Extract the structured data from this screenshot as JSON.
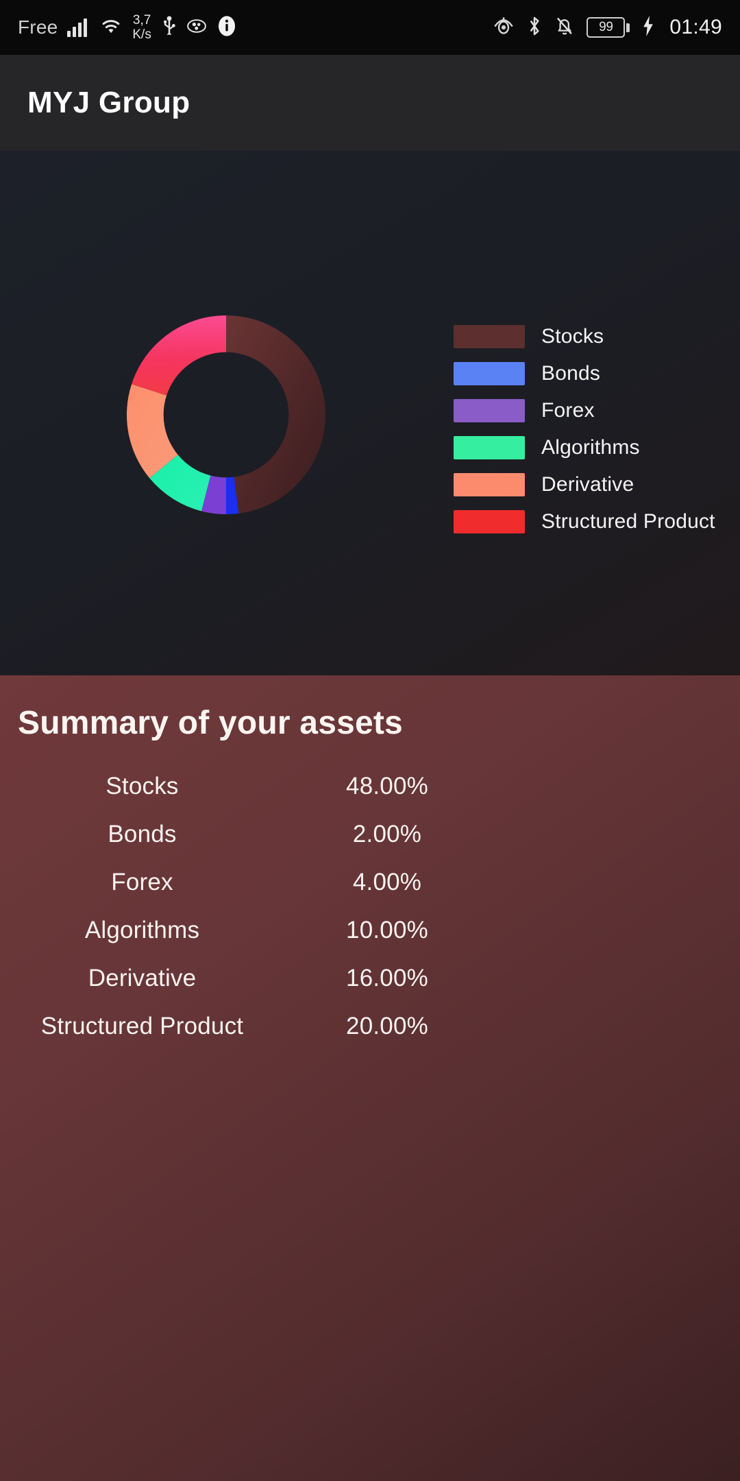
{
  "status_bar": {
    "carrier": "Free",
    "net_speed_value": "3,7",
    "net_speed_unit": "K/s",
    "battery_percent": "99",
    "time": "01:49",
    "icons": [
      "signal-icon",
      "wifi-icon",
      "usb-icon",
      "cast-icon",
      "info-icon",
      "eye-icon",
      "bluetooth-icon",
      "bell-muted-icon",
      "battery-icon",
      "charging-bolt-icon"
    ]
  },
  "app_bar": {
    "title": "MYJ Group"
  },
  "legend": {
    "items": [
      {
        "label": "Stocks",
        "color": "#5d2f2f"
      },
      {
        "label": "Bonds",
        "color": "#5b82f5"
      },
      {
        "label": "Forex",
        "color": "#8a5cc8"
      },
      {
        "label": "Algorithms",
        "color": "#35eea0"
      },
      {
        "label": "Derivative",
        "color": "#fc8b6e"
      },
      {
        "label": "Structured Product",
        "color": "#f02c2c"
      }
    ]
  },
  "summary": {
    "title": "Summary of your assets",
    "rows": [
      {
        "label": "Stocks",
        "value": "48.00%"
      },
      {
        "label": "Bonds",
        "value": "2.00%"
      },
      {
        "label": "Forex",
        "value": "4.00%"
      },
      {
        "label": "Algorithms",
        "value": "10.00%"
      },
      {
        "label": "Derivative",
        "value": "16.00%"
      },
      {
        "label": "Structured Product",
        "value": "20.00%"
      }
    ]
  },
  "chart_data": {
    "type": "pie",
    "title": "",
    "variant": "donut",
    "start_angle": 0,
    "direction": "clockwise",
    "inner_radius_ratio": 0.63,
    "categories": [
      "Stocks",
      "Bonds",
      "Forex",
      "Algorithms",
      "Derivative",
      "Structured Product"
    ],
    "values": [
      48.0,
      2.0,
      4.0,
      10.0,
      16.0,
      20.0
    ],
    "unit": "%",
    "colors": [
      "#5d2f2f",
      "#1a2ff2",
      "#7b3fd4",
      "#19f0a8",
      "#fc9272",
      "#f23a52"
    ],
    "legend_position": "right",
    "grid": false
  }
}
